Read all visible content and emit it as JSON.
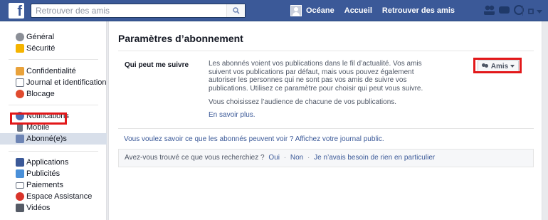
{
  "topbar": {
    "logo_letter": "f",
    "search_placeholder": "Retrouver des amis",
    "user_name": "Océane",
    "nav_home": "Accueil",
    "nav_find_friends": "Retrouver des amis",
    "brand_color": "#3b5998"
  },
  "sidebar": {
    "group1": [
      {
        "label": "Général",
        "icon": "gears-icon"
      },
      {
        "label": "Sécurité",
        "icon": "shield-icon"
      }
    ],
    "group2": [
      {
        "label": "Confidentialité",
        "icon": "lock-icon"
      },
      {
        "label": "Journal et identification",
        "icon": "timeline-icon"
      },
      {
        "label": "Blocage",
        "icon": "block-icon"
      }
    ],
    "group3": [
      {
        "label": "Notifications",
        "icon": "globe-icon"
      },
      {
        "label": "Mobile",
        "icon": "mobile-icon"
      },
      {
        "label": "Abonné(e)s",
        "icon": "rss-icon",
        "selected": true
      }
    ],
    "group4": [
      {
        "label": "Applications",
        "icon": "apps-icon"
      },
      {
        "label": "Publicités",
        "icon": "ads-icon"
      },
      {
        "label": "Paiements",
        "icon": "card-icon"
      },
      {
        "label": "Espace Assistance",
        "icon": "lifebuoy-icon"
      },
      {
        "label": "Vidéos",
        "icon": "film-icon"
      }
    ]
  },
  "main": {
    "title": "Paramètres d’abonnement",
    "setting_label": "Qui peut me suivre",
    "setting_description": "Les abonnés voient vos publications dans le fil d’actualité. Vos amis suivent vos publications par défaut, mais vous pouvez également autoriser les personnes qui ne sont pas vos amis de suivre vos publications. Utilisez ce paramètre pour choisir qui peut vous suivre.",
    "audience_text": "Vous choisissez l’audience de chacune de vos publications.",
    "learn_more": "En savoir plus.",
    "audience_button": "Amis",
    "public_link": "Vous voulez savoir ce que les abonnés peuvent voir ? Affichez votre journal public.",
    "feedback_question": "Avez-vous trouvé ce que vous recherchiez ?",
    "feedback_yes": "Oui",
    "feedback_no": "Non",
    "feedback_other": "Je n’avais besoin de rien en particulier",
    "feedback_separator": "·"
  },
  "annotation_color": "#e2181a"
}
